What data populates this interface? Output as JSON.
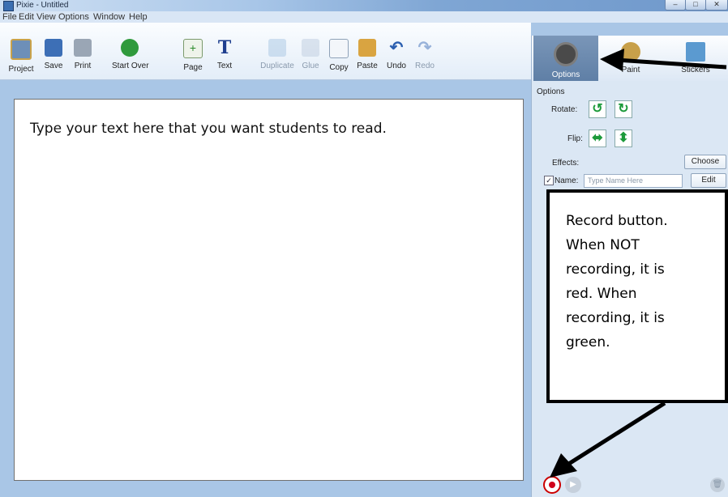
{
  "window": {
    "title": "Pixie - Untitled"
  },
  "menu": [
    "File",
    "Edit",
    "View",
    "Options",
    "Window",
    "Help"
  ],
  "toolbar": {
    "project": "Project",
    "save": "Save",
    "print": "Print",
    "start_over": "Start Over",
    "page": "Page",
    "text": "Text",
    "duplicate": "Duplicate",
    "glue": "Glue",
    "copy": "Copy",
    "paste": "Paste",
    "undo": "Undo",
    "redo": "Redo"
  },
  "tabs": {
    "options": "Options",
    "paint": "Paint",
    "stickers": "Stickers"
  },
  "canvas": {
    "text": "Type your text here that you want students to read."
  },
  "options": {
    "header": "Options",
    "rotate_label": "Rotate:",
    "flip_label": "Flip:",
    "effects_label": "Effects:",
    "choose_button": "Choose",
    "name_label": "Name:",
    "name_placeholder": "Type Name Here",
    "edit_button": "Edit",
    "name_checked": true
  },
  "callout": {
    "lines": [
      "Record button.",
      "When NOT",
      "recording, it is",
      "red. When",
      "recording, it is",
      "green."
    ]
  },
  "colors": {
    "record": "#d0021b",
    "toolbar_bg": "#e3edf8",
    "canvas_bg": "#a9c6e6"
  }
}
